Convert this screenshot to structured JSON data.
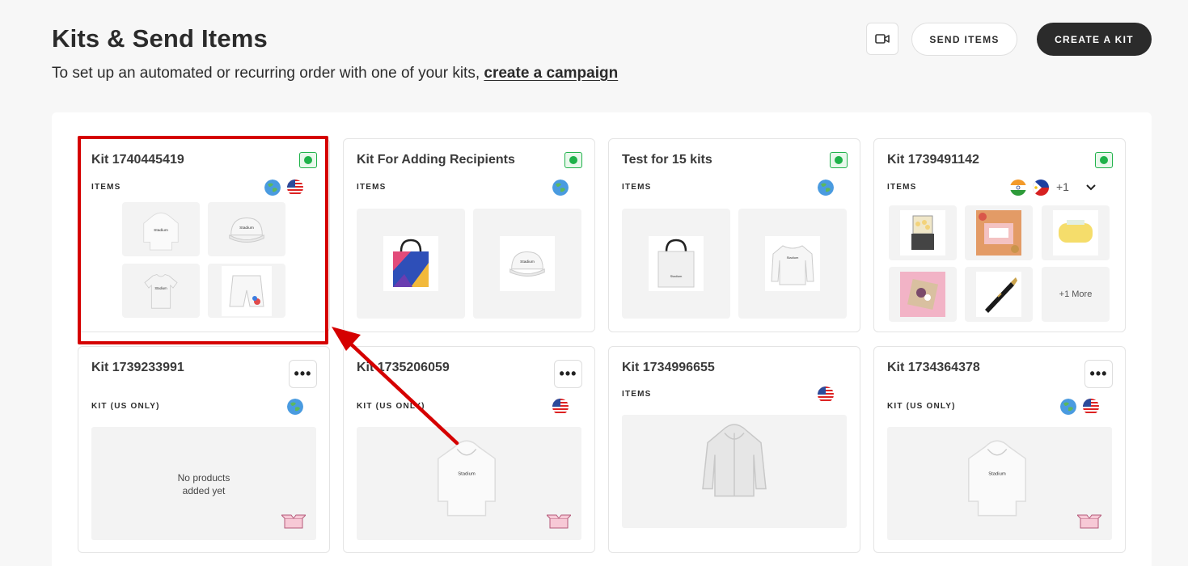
{
  "header": {
    "title": "Kits & Send Items",
    "subtitle_prefix": "To set up an automated or recurring order with one of your kits,",
    "subtitle_link": "create a campaign",
    "send_items_label": "SEND ITEMS",
    "create_kit_label": "CREATE A KIT"
  },
  "kits": [
    {
      "title": "Kit 1740445419",
      "label": "ITEMS",
      "status": "active",
      "regions": [
        "globe",
        "us-flag"
      ],
      "items": [
        "hoodie",
        "cap",
        "t-shirt",
        "shorts"
      ]
    },
    {
      "title": "Kit For Adding Recipients",
      "label": "ITEMS",
      "status": "active",
      "regions": [
        "globe"
      ],
      "items": [
        "tote-bag-colorful",
        "cap"
      ]
    },
    {
      "title": "Test for 15 kits",
      "label": "ITEMS",
      "status": "active",
      "regions": [
        "globe"
      ],
      "items": [
        "tote-bag-white",
        "sweatshirt"
      ]
    },
    {
      "title": "Kit 1739491142",
      "label": "ITEMS",
      "status": "active",
      "regions": [
        "india-flag",
        "philippines-flag"
      ],
      "extra_regions": "+1",
      "items": [
        "popcorn-maker",
        "snack-box",
        "soap",
        "gift-box",
        "pen"
      ],
      "more_items": "+1 More"
    },
    {
      "title": "Kit 1739233991",
      "label": "KIT (US ONLY)",
      "regions": [
        "globe"
      ],
      "empty_line1": "No products",
      "empty_line2": "added yet"
    },
    {
      "title": "Kit 1735206059",
      "label": "KIT (US ONLY)",
      "regions": [
        "us-flag"
      ],
      "items": [
        "hoodie"
      ]
    },
    {
      "title": "Kit 1734996655",
      "label": "ITEMS",
      "regions": [
        "us-flag"
      ],
      "items": [
        "windbreaker"
      ]
    },
    {
      "title": "Kit 1734364378",
      "label": "KIT (US ONLY)",
      "regions": [
        "globe",
        "us-flag"
      ],
      "items": [
        "hoodie"
      ]
    }
  ],
  "more_button_label": "•••",
  "colors": {
    "accent_dark": "#2b2b2b",
    "status_green": "#1fb24a",
    "highlight_red": "#d50000"
  }
}
